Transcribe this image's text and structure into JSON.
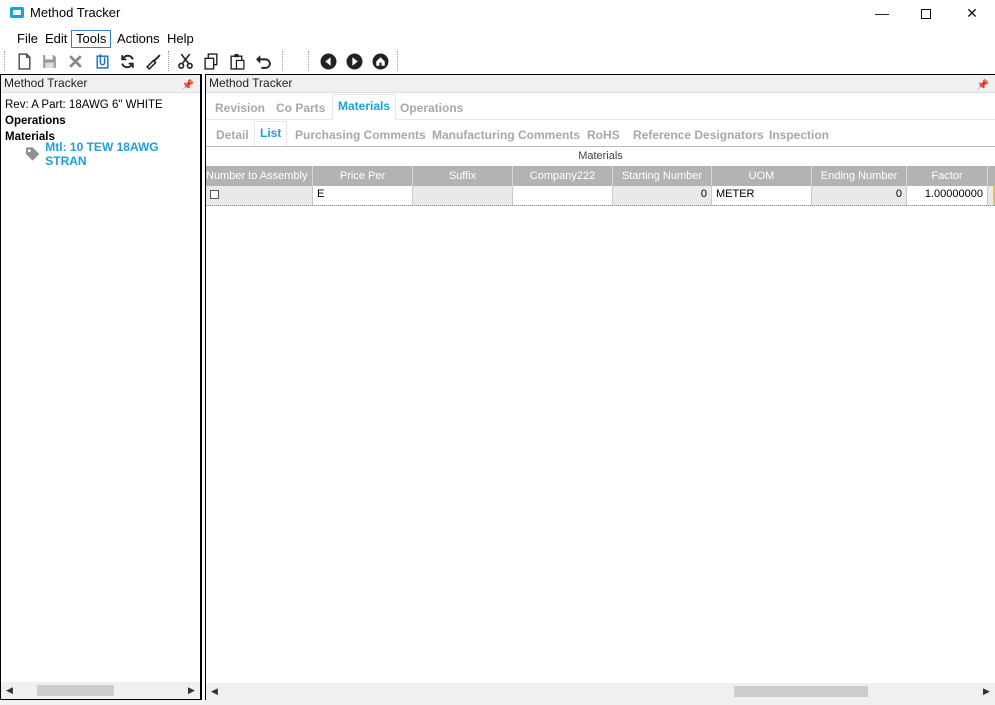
{
  "window": {
    "title": "Method Tracker"
  },
  "menu": [
    "File",
    "Edit",
    "Tools",
    "Actions",
    "Help"
  ],
  "toolbar": {
    "buttons": [
      "new-icon",
      "save-icon",
      "delete-icon",
      "attach-icon",
      "refresh-icon",
      "clear-icon",
      "cut-icon",
      "copy-icon",
      "paste-icon",
      "undo-icon",
      "back-icon",
      "forward-icon",
      "home-icon"
    ]
  },
  "left_panel": {
    "title": "Method Tracker",
    "tree": {
      "rev": "Rev: A Part: 18AWG 6\" WHITE",
      "operations": "Operations",
      "materials": "Materials",
      "mtl_item": "Mtl: 10 TEW 18AWG STRAN"
    }
  },
  "right_panel": {
    "title": "Method Tracker",
    "tabs": [
      "Revision",
      "Co Parts",
      "Materials",
      "Operations"
    ],
    "active_tab": "Materials",
    "subtabs": [
      "Detail",
      "List",
      "Purchasing Comments",
      "Manufacturing Comments",
      "RoHS",
      "Reference Designators",
      "Inspection"
    ],
    "active_subtab": "List",
    "grid": {
      "title": "Materials",
      "columns": [
        "Number to Assembly",
        "Price Per",
        "Suffix",
        "Company222",
        "Starting Number",
        "UOM",
        "Ending Number",
        "Factor"
      ],
      "rows": [
        {
          "number_to_assembly": false,
          "price_per": "E",
          "suffix": "",
          "company222": "",
          "starting_number": "0",
          "uom": "METER",
          "ending_number": "0",
          "factor": "1.00000000"
        }
      ]
    }
  },
  "colors": {
    "accent": "#1ea1d9",
    "grid_header": "#b3b3b3",
    "inactive_tab": "#a8a8a8"
  }
}
